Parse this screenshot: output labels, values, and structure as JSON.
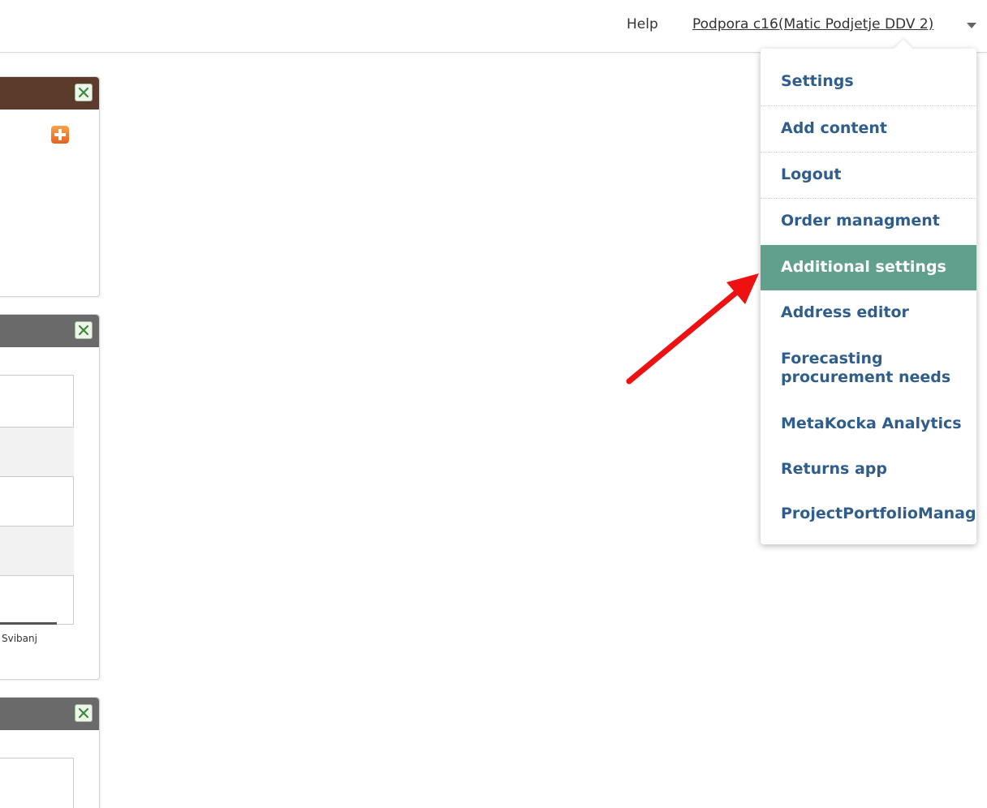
{
  "header": {
    "help_label": "Help",
    "user_label": "Podpora c16(Matic Podjetje DDV 2)"
  },
  "dropdown": {
    "items": [
      {
        "label": "Settings"
      },
      {
        "label": "Add content"
      },
      {
        "label": "Logout"
      },
      {
        "label": "Order managment"
      },
      {
        "label": "Additional settings",
        "active": true
      },
      {
        "label": "Address editor"
      },
      {
        "label": "Forecasting procurement needs"
      },
      {
        "label": "MetaKocka Analytics"
      },
      {
        "label": "Returns app"
      },
      {
        "label": "ProjectPortfolioManageme"
      }
    ],
    "forecast_line1": "Forecasting",
    "forecast_line2": "procurement needs"
  },
  "widgets": {
    "chart_tick_label": "Svibanj"
  },
  "colors": {
    "menu_text": "#2f5d8c",
    "menu_active_bg": "#62a08e",
    "widget_header_brown": "#5c3a2c",
    "widget_header_gray": "#6a6a6a",
    "annotation_arrow": "#ee1111"
  }
}
